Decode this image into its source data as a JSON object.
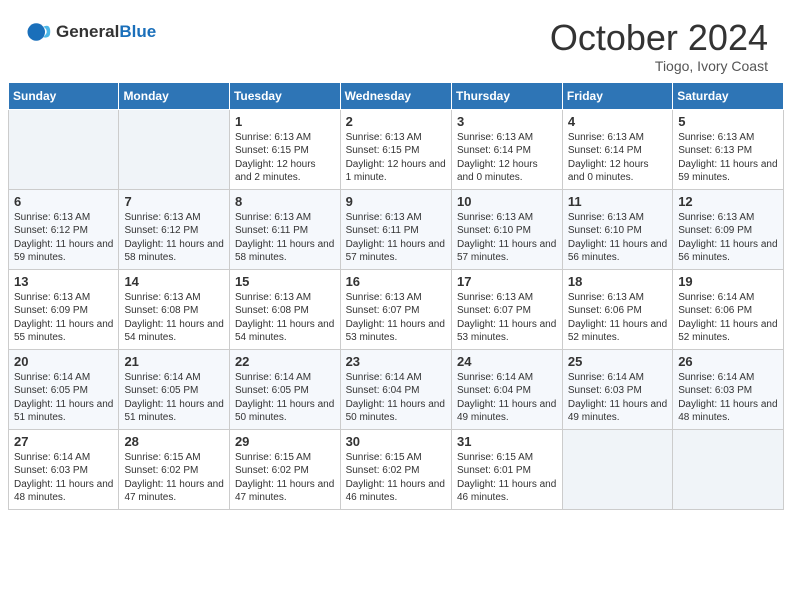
{
  "header": {
    "logo_general": "General",
    "logo_blue": "Blue",
    "month_title": "October 2024",
    "location": "Tiogo, Ivory Coast"
  },
  "weekdays": [
    "Sunday",
    "Monday",
    "Tuesday",
    "Wednesday",
    "Thursday",
    "Friday",
    "Saturday"
  ],
  "weeks": [
    [
      {
        "day": "",
        "sunrise": "",
        "sunset": "",
        "daylight": ""
      },
      {
        "day": "",
        "sunrise": "",
        "sunset": "",
        "daylight": ""
      },
      {
        "day": "1",
        "sunrise": "Sunrise: 6:13 AM",
        "sunset": "Sunset: 6:15 PM",
        "daylight": "Daylight: 12 hours and 2 minutes."
      },
      {
        "day": "2",
        "sunrise": "Sunrise: 6:13 AM",
        "sunset": "Sunset: 6:15 PM",
        "daylight": "Daylight: 12 hours and 1 minute."
      },
      {
        "day": "3",
        "sunrise": "Sunrise: 6:13 AM",
        "sunset": "Sunset: 6:14 PM",
        "daylight": "Daylight: 12 hours and 0 minutes."
      },
      {
        "day": "4",
        "sunrise": "Sunrise: 6:13 AM",
        "sunset": "Sunset: 6:14 PM",
        "daylight": "Daylight: 12 hours and 0 minutes."
      },
      {
        "day": "5",
        "sunrise": "Sunrise: 6:13 AM",
        "sunset": "Sunset: 6:13 PM",
        "daylight": "Daylight: 11 hours and 59 minutes."
      }
    ],
    [
      {
        "day": "6",
        "sunrise": "Sunrise: 6:13 AM",
        "sunset": "Sunset: 6:12 PM",
        "daylight": "Daylight: 11 hours and 59 minutes."
      },
      {
        "day": "7",
        "sunrise": "Sunrise: 6:13 AM",
        "sunset": "Sunset: 6:12 PM",
        "daylight": "Daylight: 11 hours and 58 minutes."
      },
      {
        "day": "8",
        "sunrise": "Sunrise: 6:13 AM",
        "sunset": "Sunset: 6:11 PM",
        "daylight": "Daylight: 11 hours and 58 minutes."
      },
      {
        "day": "9",
        "sunrise": "Sunrise: 6:13 AM",
        "sunset": "Sunset: 6:11 PM",
        "daylight": "Daylight: 11 hours and 57 minutes."
      },
      {
        "day": "10",
        "sunrise": "Sunrise: 6:13 AM",
        "sunset": "Sunset: 6:10 PM",
        "daylight": "Daylight: 11 hours and 57 minutes."
      },
      {
        "day": "11",
        "sunrise": "Sunrise: 6:13 AM",
        "sunset": "Sunset: 6:10 PM",
        "daylight": "Daylight: 11 hours and 56 minutes."
      },
      {
        "day": "12",
        "sunrise": "Sunrise: 6:13 AM",
        "sunset": "Sunset: 6:09 PM",
        "daylight": "Daylight: 11 hours and 56 minutes."
      }
    ],
    [
      {
        "day": "13",
        "sunrise": "Sunrise: 6:13 AM",
        "sunset": "Sunset: 6:09 PM",
        "daylight": "Daylight: 11 hours and 55 minutes."
      },
      {
        "day": "14",
        "sunrise": "Sunrise: 6:13 AM",
        "sunset": "Sunset: 6:08 PM",
        "daylight": "Daylight: 11 hours and 54 minutes."
      },
      {
        "day": "15",
        "sunrise": "Sunrise: 6:13 AM",
        "sunset": "Sunset: 6:08 PM",
        "daylight": "Daylight: 11 hours and 54 minutes."
      },
      {
        "day": "16",
        "sunrise": "Sunrise: 6:13 AM",
        "sunset": "Sunset: 6:07 PM",
        "daylight": "Daylight: 11 hours and 53 minutes."
      },
      {
        "day": "17",
        "sunrise": "Sunrise: 6:13 AM",
        "sunset": "Sunset: 6:07 PM",
        "daylight": "Daylight: 11 hours and 53 minutes."
      },
      {
        "day": "18",
        "sunrise": "Sunrise: 6:13 AM",
        "sunset": "Sunset: 6:06 PM",
        "daylight": "Daylight: 11 hours and 52 minutes."
      },
      {
        "day": "19",
        "sunrise": "Sunrise: 6:14 AM",
        "sunset": "Sunset: 6:06 PM",
        "daylight": "Daylight: 11 hours and 52 minutes."
      }
    ],
    [
      {
        "day": "20",
        "sunrise": "Sunrise: 6:14 AM",
        "sunset": "Sunset: 6:05 PM",
        "daylight": "Daylight: 11 hours and 51 minutes."
      },
      {
        "day": "21",
        "sunrise": "Sunrise: 6:14 AM",
        "sunset": "Sunset: 6:05 PM",
        "daylight": "Daylight: 11 hours and 51 minutes."
      },
      {
        "day": "22",
        "sunrise": "Sunrise: 6:14 AM",
        "sunset": "Sunset: 6:05 PM",
        "daylight": "Daylight: 11 hours and 50 minutes."
      },
      {
        "day": "23",
        "sunrise": "Sunrise: 6:14 AM",
        "sunset": "Sunset: 6:04 PM",
        "daylight": "Daylight: 11 hours and 50 minutes."
      },
      {
        "day": "24",
        "sunrise": "Sunrise: 6:14 AM",
        "sunset": "Sunset: 6:04 PM",
        "daylight": "Daylight: 11 hours and 49 minutes."
      },
      {
        "day": "25",
        "sunrise": "Sunrise: 6:14 AM",
        "sunset": "Sunset: 6:03 PM",
        "daylight": "Daylight: 11 hours and 49 minutes."
      },
      {
        "day": "26",
        "sunrise": "Sunrise: 6:14 AM",
        "sunset": "Sunset: 6:03 PM",
        "daylight": "Daylight: 11 hours and 48 minutes."
      }
    ],
    [
      {
        "day": "27",
        "sunrise": "Sunrise: 6:14 AM",
        "sunset": "Sunset: 6:03 PM",
        "daylight": "Daylight: 11 hours and 48 minutes."
      },
      {
        "day": "28",
        "sunrise": "Sunrise: 6:15 AM",
        "sunset": "Sunset: 6:02 PM",
        "daylight": "Daylight: 11 hours and 47 minutes."
      },
      {
        "day": "29",
        "sunrise": "Sunrise: 6:15 AM",
        "sunset": "Sunset: 6:02 PM",
        "daylight": "Daylight: 11 hours and 47 minutes."
      },
      {
        "day": "30",
        "sunrise": "Sunrise: 6:15 AM",
        "sunset": "Sunset: 6:02 PM",
        "daylight": "Daylight: 11 hours and 46 minutes."
      },
      {
        "day": "31",
        "sunrise": "Sunrise: 6:15 AM",
        "sunset": "Sunset: 6:01 PM",
        "daylight": "Daylight: 11 hours and 46 minutes."
      },
      {
        "day": "",
        "sunrise": "",
        "sunset": "",
        "daylight": ""
      },
      {
        "day": "",
        "sunrise": "",
        "sunset": "",
        "daylight": ""
      }
    ]
  ]
}
